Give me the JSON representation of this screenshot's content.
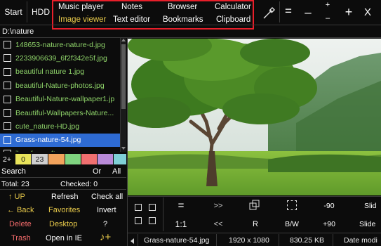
{
  "topbar": {
    "start_label": "Start",
    "hdd_label": "HDD",
    "equals_label": "=",
    "minus_label": "–",
    "plus_minus_top": "+",
    "plus_minus_bottom": "–",
    "plus_label": "+",
    "close_label": "X"
  },
  "launcher": {
    "items": [
      {
        "label": "Music player",
        "color": "#ffffff"
      },
      {
        "label": "Notes",
        "color": "#ffffff"
      },
      {
        "label": "Browser",
        "color": "#ffffff"
      },
      {
        "label": "Calculator",
        "color": "#ffffff"
      },
      {
        "label": "Image viewer",
        "color": "#e7c94a"
      },
      {
        "label": "Text editor",
        "color": "#ffffff"
      },
      {
        "label": "Bookmarks",
        "color": "#ffffff"
      },
      {
        "label": "Clipboard",
        "color": "#ffffff"
      }
    ]
  },
  "path": "D:\\nature",
  "files": [
    {
      "name": "148653-nature-nature-d.jpg",
      "selected": false
    },
    {
      "name": "2233906639_6f2f342e5f.jpg",
      "selected": false
    },
    {
      "name": "beautiful nature 1.jpg",
      "selected": false
    },
    {
      "name": "beautiful-Nature-photos.jpg",
      "selected": false
    },
    {
      "name": "Beautiful-Nature-wallpaper1.jp",
      "selected": false
    },
    {
      "name": "Beautiful-Wallpapers-Nature...",
      "selected": false
    },
    {
      "name": "cute_nature-HD.jpg",
      "selected": false
    },
    {
      "name": "Grass-nature-54.jpg",
      "selected": true
    },
    {
      "name": "ilovefreesoftware.png",
      "selected": false
    }
  ],
  "filter": {
    "mode_label": "2+",
    "swatches": [
      {
        "label": "0",
        "color": "#e8e35a"
      },
      {
        "label": "23",
        "color": "#cfcfcf"
      },
      {
        "label": "",
        "color": "#f2a35c"
      },
      {
        "label": "",
        "color": "#7fd37f"
      },
      {
        "label": "",
        "color": "#f07070"
      },
      {
        "label": "",
        "color": "#b98ad8"
      },
      {
        "label": "",
        "color": "#7fd0d6"
      }
    ]
  },
  "search": {
    "label": "Search",
    "or_label": "Or",
    "all_label": "All"
  },
  "counts": {
    "total": "Total: 23",
    "checked": "Checked: 0"
  },
  "actions": {
    "up": "↑ UP",
    "refresh": "Refresh",
    "check_all": "Check all",
    "back": "← Back",
    "favorites": "Favorites",
    "invert": "Invert",
    "delete": "Delete",
    "desktop": "Desktop",
    "help": "?",
    "trash": "Trash",
    "open_ie": "Open in IE",
    "music_plus": "♪+",
    "colors": {
      "up": "#e7c94a",
      "back": "#e7c94a",
      "delete": "#f06a6a",
      "trash": "#f06a6a",
      "favorites": "#e7c94a",
      "desktop": "#e7c94a",
      "refresh": "#ffffff",
      "check_all": "#ffffff",
      "invert": "#ffffff",
      "help": "#ffffff",
      "open_ie": "#ffffff",
      "music_plus": "#e7c94a"
    }
  },
  "image_controls": {
    "equals": "=",
    "next": ">>",
    "minus90": "-90",
    "slideshow_top": "Slid",
    "one_to_one": "1:1",
    "prev": "<<",
    "rotate": "R",
    "bw": "B/W",
    "plus90": "+90",
    "slideshow_bottom": "Slide"
  },
  "status": {
    "filename": "Grass-nature-54.jpg",
    "dimensions": "1920 x 1080",
    "filesize": "830.25 KB",
    "date_mode": "Date modi"
  }
}
